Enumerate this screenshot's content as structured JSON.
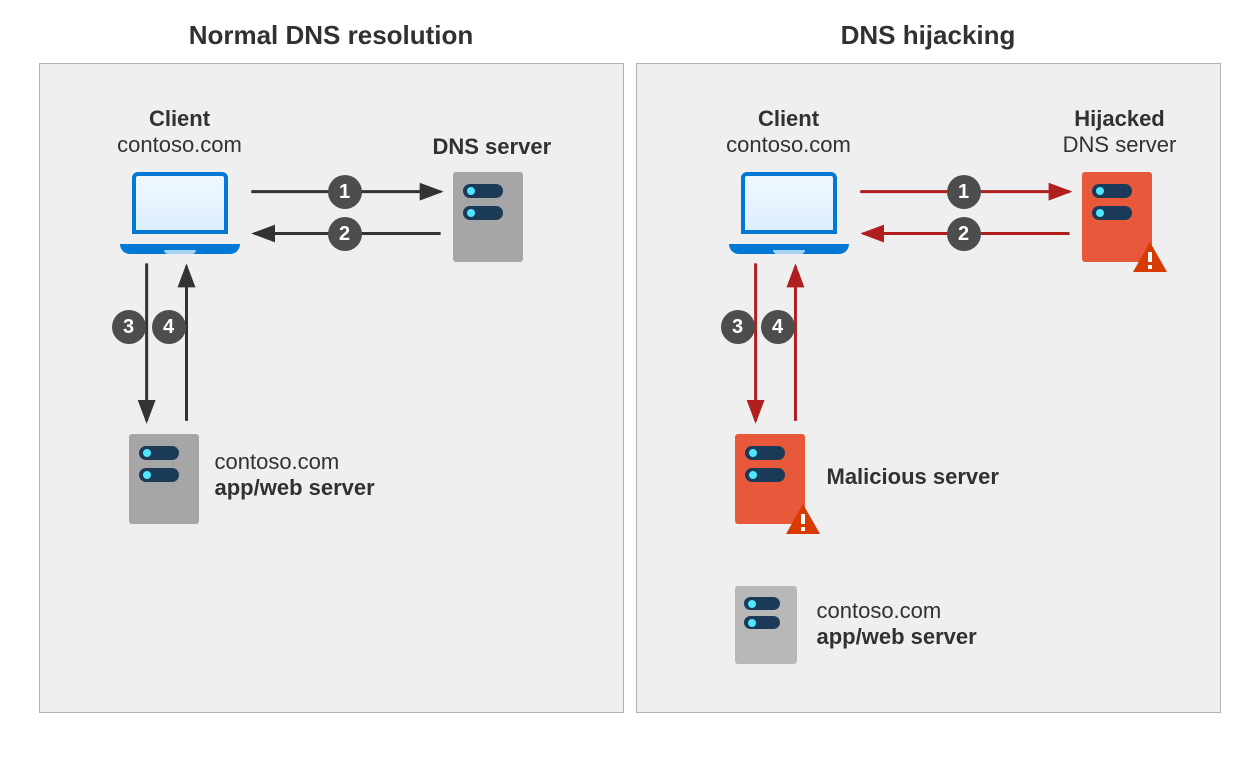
{
  "panels": {
    "left": {
      "title": "Normal DNS resolution"
    },
    "right": {
      "title": "DNS hijacking"
    }
  },
  "labels": {
    "client_title": "Client",
    "client_domain": "contoso.com",
    "dns_server": "DNS server",
    "hijacked_title": "Hijacked",
    "hijacked_sub": "DNS server",
    "appweb_domain": "contoso.com",
    "appweb_role": "app/web server",
    "malicious": "Malicious server"
  },
  "steps": {
    "s1": "1",
    "s2": "2",
    "s3": "3",
    "s4": "4"
  },
  "colors": {
    "arrow_normal": "#333333",
    "arrow_attack": "#b01e1e"
  }
}
